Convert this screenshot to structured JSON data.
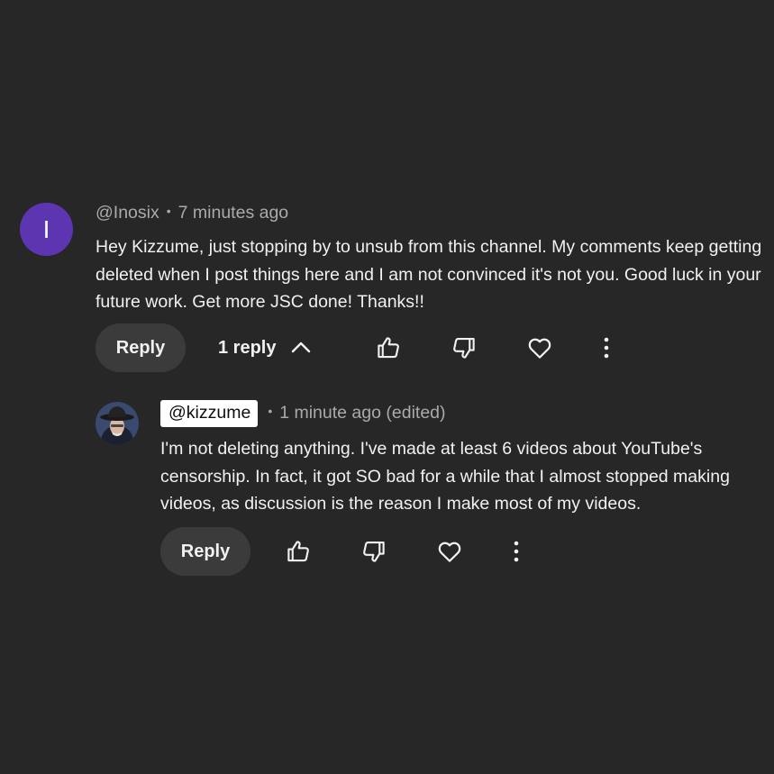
{
  "comment": {
    "avatar_letter": "I",
    "author": "@Inosix",
    "time": "7 minutes ago",
    "text": "Hey Kizzume, just stopping by to unsub from this channel. My comments keep getting deleted when I post things here and I am not convinced it's not you. Good luck in your future work. Get more JSC done! Thanks!!",
    "reply_label": "Reply",
    "replies_label": "1 reply"
  },
  "reply": {
    "author": "@kizzume",
    "time": "1 minute ago (edited)",
    "text": "I'm not deleting anything.  I've made at least 6 videos about YouTube's censorship.  In fact, it got SO bad for a while that I almost stopped making videos, as discussion is the reason I make most of my videos.",
    "reply_label": "Reply"
  },
  "colors": {
    "background": "#272727",
    "avatar": "#5e35b1",
    "meta_text": "#aaaaaa",
    "button_bg": "#3b3b3b"
  },
  "icons": [
    "chevron-up-icon",
    "thumbs-up-icon",
    "thumbs-down-icon",
    "heart-icon",
    "more-vert-icon"
  ]
}
